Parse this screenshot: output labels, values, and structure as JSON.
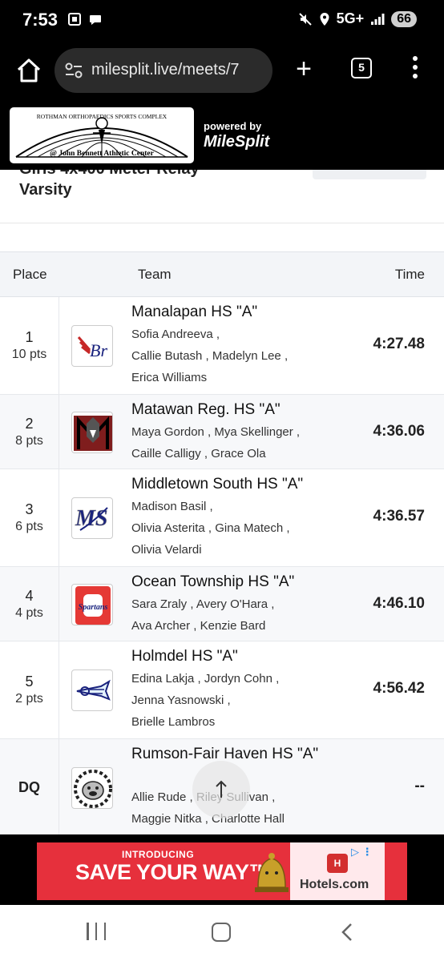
{
  "status": {
    "time": "7:53",
    "network": "5G+",
    "battery": "66"
  },
  "browser": {
    "url": "milesplit.live/meets/7",
    "tab_count": "5"
  },
  "site": {
    "logo_text_top": "ROTHMAN ORTHOPAEDICS SPORTS COMPLEX",
    "logo_text_bottom": "@ John Bennett Athletic Center",
    "powered_by": "powered by",
    "brand": "MileSplit"
  },
  "event": {
    "title_partial": "Girls 4x400 Meter Relay",
    "title": "Varsity"
  },
  "table": {
    "headers": {
      "place": "Place",
      "team": "Team",
      "time": "Time"
    },
    "rows": [
      {
        "place": "1",
        "pts": "10 pts",
        "team": "Manalapan HS \"A\"",
        "athlete_lines": [
          "Sofia Andreeva ,",
          "Callie Butash , Madelyn Lee ,",
          "Erica Williams"
        ],
        "time": "4:27.48"
      },
      {
        "place": "2",
        "pts": "8 pts",
        "team": "Matawan Reg. HS \"A\"",
        "athlete_lines": [
          "Maya Gordon , Mya Skellinger ,",
          "Caille Calligy , Grace Ola"
        ],
        "time": "4:36.06"
      },
      {
        "place": "3",
        "pts": "6 pts",
        "team": "Middletown South HS \"A\"",
        "athlete_lines": [
          "Madison Basil ,",
          "Olivia Asterita , Gina Matech ,",
          "Olivia Velardi"
        ],
        "time": "4:36.57"
      },
      {
        "place": "4",
        "pts": "4 pts",
        "team": "Ocean Township HS \"A\"",
        "athlete_lines": [
          "Sara Zraly , Avery O'Hara ,",
          "Ava Archer , Kenzie Bard"
        ],
        "time": "4:46.10"
      },
      {
        "place": "5",
        "pts": "2 pts",
        "team": "Holmdel HS \"A\"",
        "athlete_lines": [
          "Edina Lakja , Jordyn Cohn ,",
          "Jenna Yasnowski ,",
          "Brielle Lambros"
        ],
        "time": "4:56.42"
      },
      {
        "place": "DQ",
        "pts": "",
        "team": "Rumson-Fair Haven HS \"A\"",
        "athlete_lines": [
          "Allie Rude , Riley Sullivan ,",
          "Maggie Nitka , Charlotte Hall"
        ],
        "time": "--"
      }
    ]
  },
  "ad": {
    "intro": "INTRODUCING",
    "headline": "SAVE YOUR WAY™",
    "brand": "Hotels.com"
  },
  "colors": {
    "ad_red": "#e6303c",
    "header_bg": "#000000"
  }
}
